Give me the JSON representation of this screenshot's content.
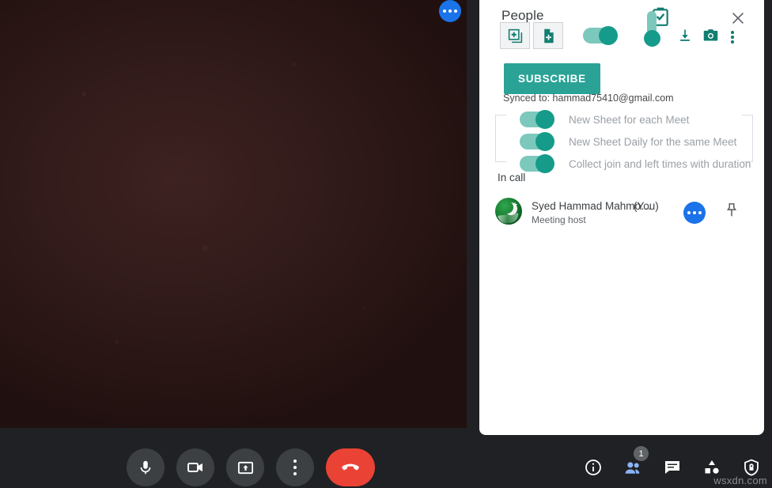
{
  "video": {
    "more_button_icon": "more-horizontal-icon"
  },
  "panel": {
    "title": "People",
    "close_icon": "close-icon",
    "clipboard_icon": "clipboard-check-icon",
    "addon": {
      "existing_sheet_button_icon": "add-to-sheet-icon",
      "new_document_button_icon": "new-document-icon",
      "master_toggle_icon": "toggle-on-icon",
      "thermometer_icon": "thermometer-slider-icon",
      "download_icon": "download-icon",
      "camera_icon": "camera-icon",
      "overflow_icon": "more-vertical-icon",
      "subscribe_label": "SUBSCRIBE",
      "synced_text": "Synced to: hammad75410@gmail.com"
    },
    "settings": [
      {
        "label": "New Sheet for each Meet",
        "state": "on"
      },
      {
        "label": "New Sheet Daily for the same Meet",
        "state": "on"
      },
      {
        "label": "Collect join and left times with duration",
        "state": "on"
      }
    ],
    "section_label": "In call",
    "participant": {
      "name": "Syed Hammad Mahmo…",
      "you_tag": "(You)",
      "role": "Meeting host",
      "avatar_icon": "pakistan-flag-avatar",
      "more_icon": "more-horizontal-icon",
      "pin_icon": "pin-icon"
    }
  },
  "call_controls": [
    {
      "name": "microphone",
      "icon": "microphone-icon"
    },
    {
      "name": "camera",
      "icon": "video-camera-icon"
    },
    {
      "name": "present-screen",
      "icon": "present-screen-icon"
    },
    {
      "name": "more-options",
      "icon": "more-vertical-icon"
    },
    {
      "name": "leave-call",
      "icon": "hangup-phone-icon"
    }
  ],
  "right_controls": [
    {
      "name": "meeting-details",
      "icon": "info-icon",
      "badge": "",
      "active": false
    },
    {
      "name": "show-everyone",
      "icon": "people-icon",
      "badge": "1",
      "active": true
    },
    {
      "name": "chat",
      "icon": "chat-icon",
      "badge": "",
      "active": false
    },
    {
      "name": "activities",
      "icon": "activities-icon",
      "badge": "",
      "active": false
    },
    {
      "name": "host-controls",
      "icon": "shield-lock-icon",
      "badge": "",
      "active": false
    }
  ],
  "watermark": "wsxdn.com",
  "colors": {
    "accent_teal": "#169b8b",
    "subscribe_teal": "#2aa396",
    "toggle_track": "#7cc8bd",
    "blue_accent": "#1a73e8",
    "blue_active": "#8ab4f8",
    "hangup_red": "#ea4335",
    "panel_bg": "#ffffff",
    "app_bg": "#202124"
  }
}
